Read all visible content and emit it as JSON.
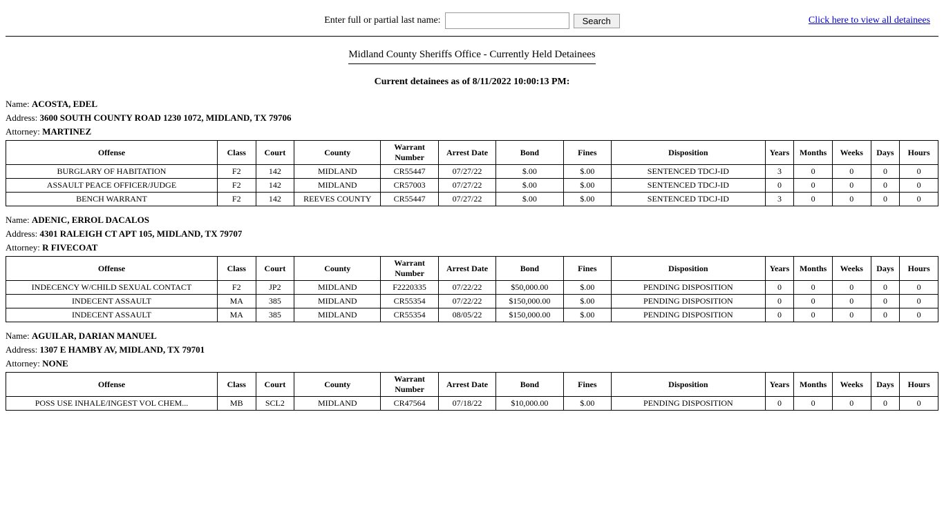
{
  "header": {
    "search_label": "Enter full or partial last name:",
    "search_placeholder": "",
    "search_button": "Search",
    "view_all_link": "Click here to view all detainees"
  },
  "page_title": "Midland County Sheriffs Office - Currently Held Detainees",
  "current_date_label": "Current detainees as of 8/11/2022 10:00:13 PM:",
  "table_headers": {
    "offense": "Offense",
    "class": "Class",
    "court": "Court",
    "county": "County",
    "warrant_number": "Warrant Number",
    "arrest_date": "Arrest Date",
    "bond": "Bond",
    "fines": "Fines",
    "disposition": "Disposition",
    "years": "Years",
    "months": "Months",
    "weeks": "Weeks",
    "days": "Days",
    "hours": "Hours"
  },
  "detainees": [
    {
      "name": "ACOSTA, EDEL",
      "address": "3600 SOUTH COUNTY ROAD 1230 1072, MIDLAND, TX 79706",
      "attorney": "MARTINEZ",
      "offenses": [
        {
          "offense": "BURGLARY OF HABITATION",
          "class": "F2",
          "court": "142",
          "county": "MIDLAND",
          "warrant_number": "CR55447",
          "arrest_date": "07/27/22",
          "bond": "$.00",
          "fines": "$.00",
          "disposition": "SENTENCED TDCJ-ID",
          "years": "3",
          "months": "0",
          "weeks": "0",
          "days": "0",
          "hours": "0"
        },
        {
          "offense": "ASSAULT PEACE OFFICER/JUDGE",
          "class": "F2",
          "court": "142",
          "county": "MIDLAND",
          "warrant_number": "CR57003",
          "arrest_date": "07/27/22",
          "bond": "$.00",
          "fines": "$.00",
          "disposition": "SENTENCED TDCJ-ID",
          "years": "0",
          "months": "0",
          "weeks": "0",
          "days": "0",
          "hours": "0"
        },
        {
          "offense": "BENCH WARRANT",
          "class": "F2",
          "court": "142",
          "county": "REEVES COUNTY",
          "warrant_number": "CR55447",
          "arrest_date": "07/27/22",
          "bond": "$.00",
          "fines": "$.00",
          "disposition": "SENTENCED TDCJ-ID",
          "years": "3",
          "months": "0",
          "weeks": "0",
          "days": "0",
          "hours": "0"
        }
      ]
    },
    {
      "name": "ADENIC, ERROL DACALOS",
      "address": "4301 RALEIGH CT APT 105, MIDLAND, TX 79707",
      "attorney": "R FIVECOAT",
      "offenses": [
        {
          "offense": "INDECENCY W/CHILD SEXUAL CONTACT",
          "class": "F2",
          "court": "JP2",
          "county": "MIDLAND",
          "warrant_number": "F2220335",
          "arrest_date": "07/22/22",
          "bond": "$50,000.00",
          "fines": "$.00",
          "disposition": "PENDING DISPOSITION",
          "years": "0",
          "months": "0",
          "weeks": "0",
          "days": "0",
          "hours": "0"
        },
        {
          "offense": "INDECENT ASSAULT",
          "class": "MA",
          "court": "385",
          "county": "MIDLAND",
          "warrant_number": "CR55354",
          "arrest_date": "07/22/22",
          "bond": "$150,000.00",
          "fines": "$.00",
          "disposition": "PENDING DISPOSITION",
          "years": "0",
          "months": "0",
          "weeks": "0",
          "days": "0",
          "hours": "0"
        },
        {
          "offense": "INDECENT ASSAULT",
          "class": "MA",
          "court": "385",
          "county": "MIDLAND",
          "warrant_number": "CR55354",
          "arrest_date": "08/05/22",
          "bond": "$150,000.00",
          "fines": "$.00",
          "disposition": "PENDING DISPOSITION",
          "years": "0",
          "months": "0",
          "weeks": "0",
          "days": "0",
          "hours": "0"
        }
      ]
    },
    {
      "name": "AGUILAR, DARIAN MANUEL",
      "address": "1307 E HAMBY AV, MIDLAND, TX 79701",
      "attorney": "NONE",
      "offenses": [
        {
          "offense": "POSS USE INHALE/INGEST VOL CHEM...",
          "class": "MB",
          "court": "SCL2",
          "county": "MIDLAND",
          "warrant_number": "CR47564",
          "arrest_date": "07/18/22",
          "bond": "$10,000.00",
          "fines": "$.00",
          "disposition": "PENDING DISPOSITION",
          "years": "0",
          "months": "0",
          "weeks": "0",
          "days": "0",
          "hours": "0"
        }
      ]
    }
  ]
}
